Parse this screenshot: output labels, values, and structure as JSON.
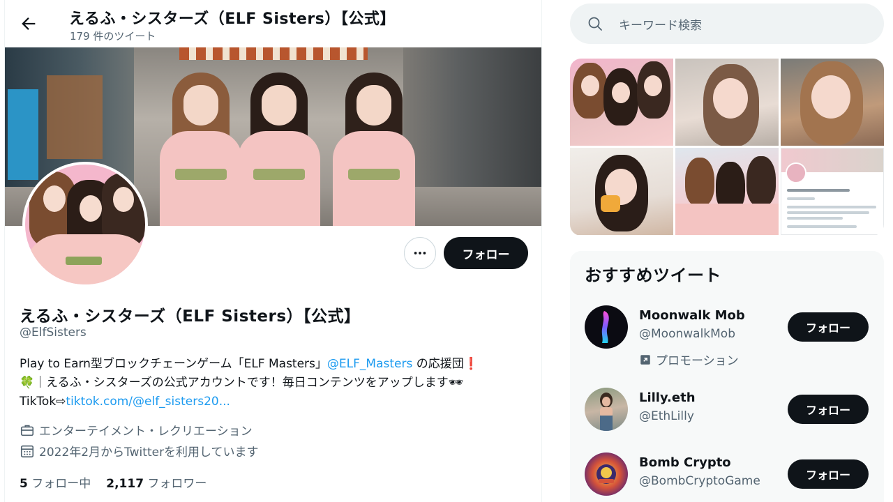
{
  "header": {
    "title": "えるふ・シスターズ（ELF Sisters）【公式】",
    "tweet_count": "179 件のツイート",
    "back_icon": "arrow-left-icon"
  },
  "profile": {
    "name": "えるふ・シスターズ（ELF Sisters）【公式】",
    "handle": "@ElfSisters",
    "follow_label": "フォロー",
    "more_icon": "more-horizontal-icon",
    "bio": {
      "line1_text": "Play to Earn型ブロックチェーンゲーム「ELF Masters」",
      "line1_mention": "@ELF_Masters",
      "line1_suffix": " の応援団",
      "line1_mark": "❗",
      "line2_icon": "🍀",
      "line2_text": "｜えるふ・シスターズの公式アカウントです！毎日コンテンツをアップします🕶",
      "line3_text": "TikTok⇨",
      "line3_link": "tiktok.com/@elf_sisters20..."
    },
    "category": "エンターテイメント・レクリエーション",
    "joined": "2022年2月からTwitterを利用しています",
    "following_count": "5",
    "following_label": " フォロー中",
    "followers_count": "2,117",
    "followers_label": " フォロワー"
  },
  "search": {
    "placeholder": "キーワード検索",
    "icon": "search-icon"
  },
  "recommended": {
    "title": "おすすめツイート",
    "accounts": [
      {
        "name": "Moonwalk Mob",
        "handle": "@MoonwalkMob",
        "promo": "プロモーション",
        "follow_label": "フォロー"
      },
      {
        "name": "Lilly.eth",
        "handle": "@EthLilly",
        "follow_label": "フォロー"
      },
      {
        "name": "Bomb Crypto",
        "handle": "@BombCryptoGame",
        "follow_label": "フォロー"
      }
    ]
  },
  "colors": {
    "accent_link": "#1d9bf0",
    "text_primary": "#0f1419",
    "text_secondary": "#536471",
    "button_dark": "#0f1419"
  }
}
